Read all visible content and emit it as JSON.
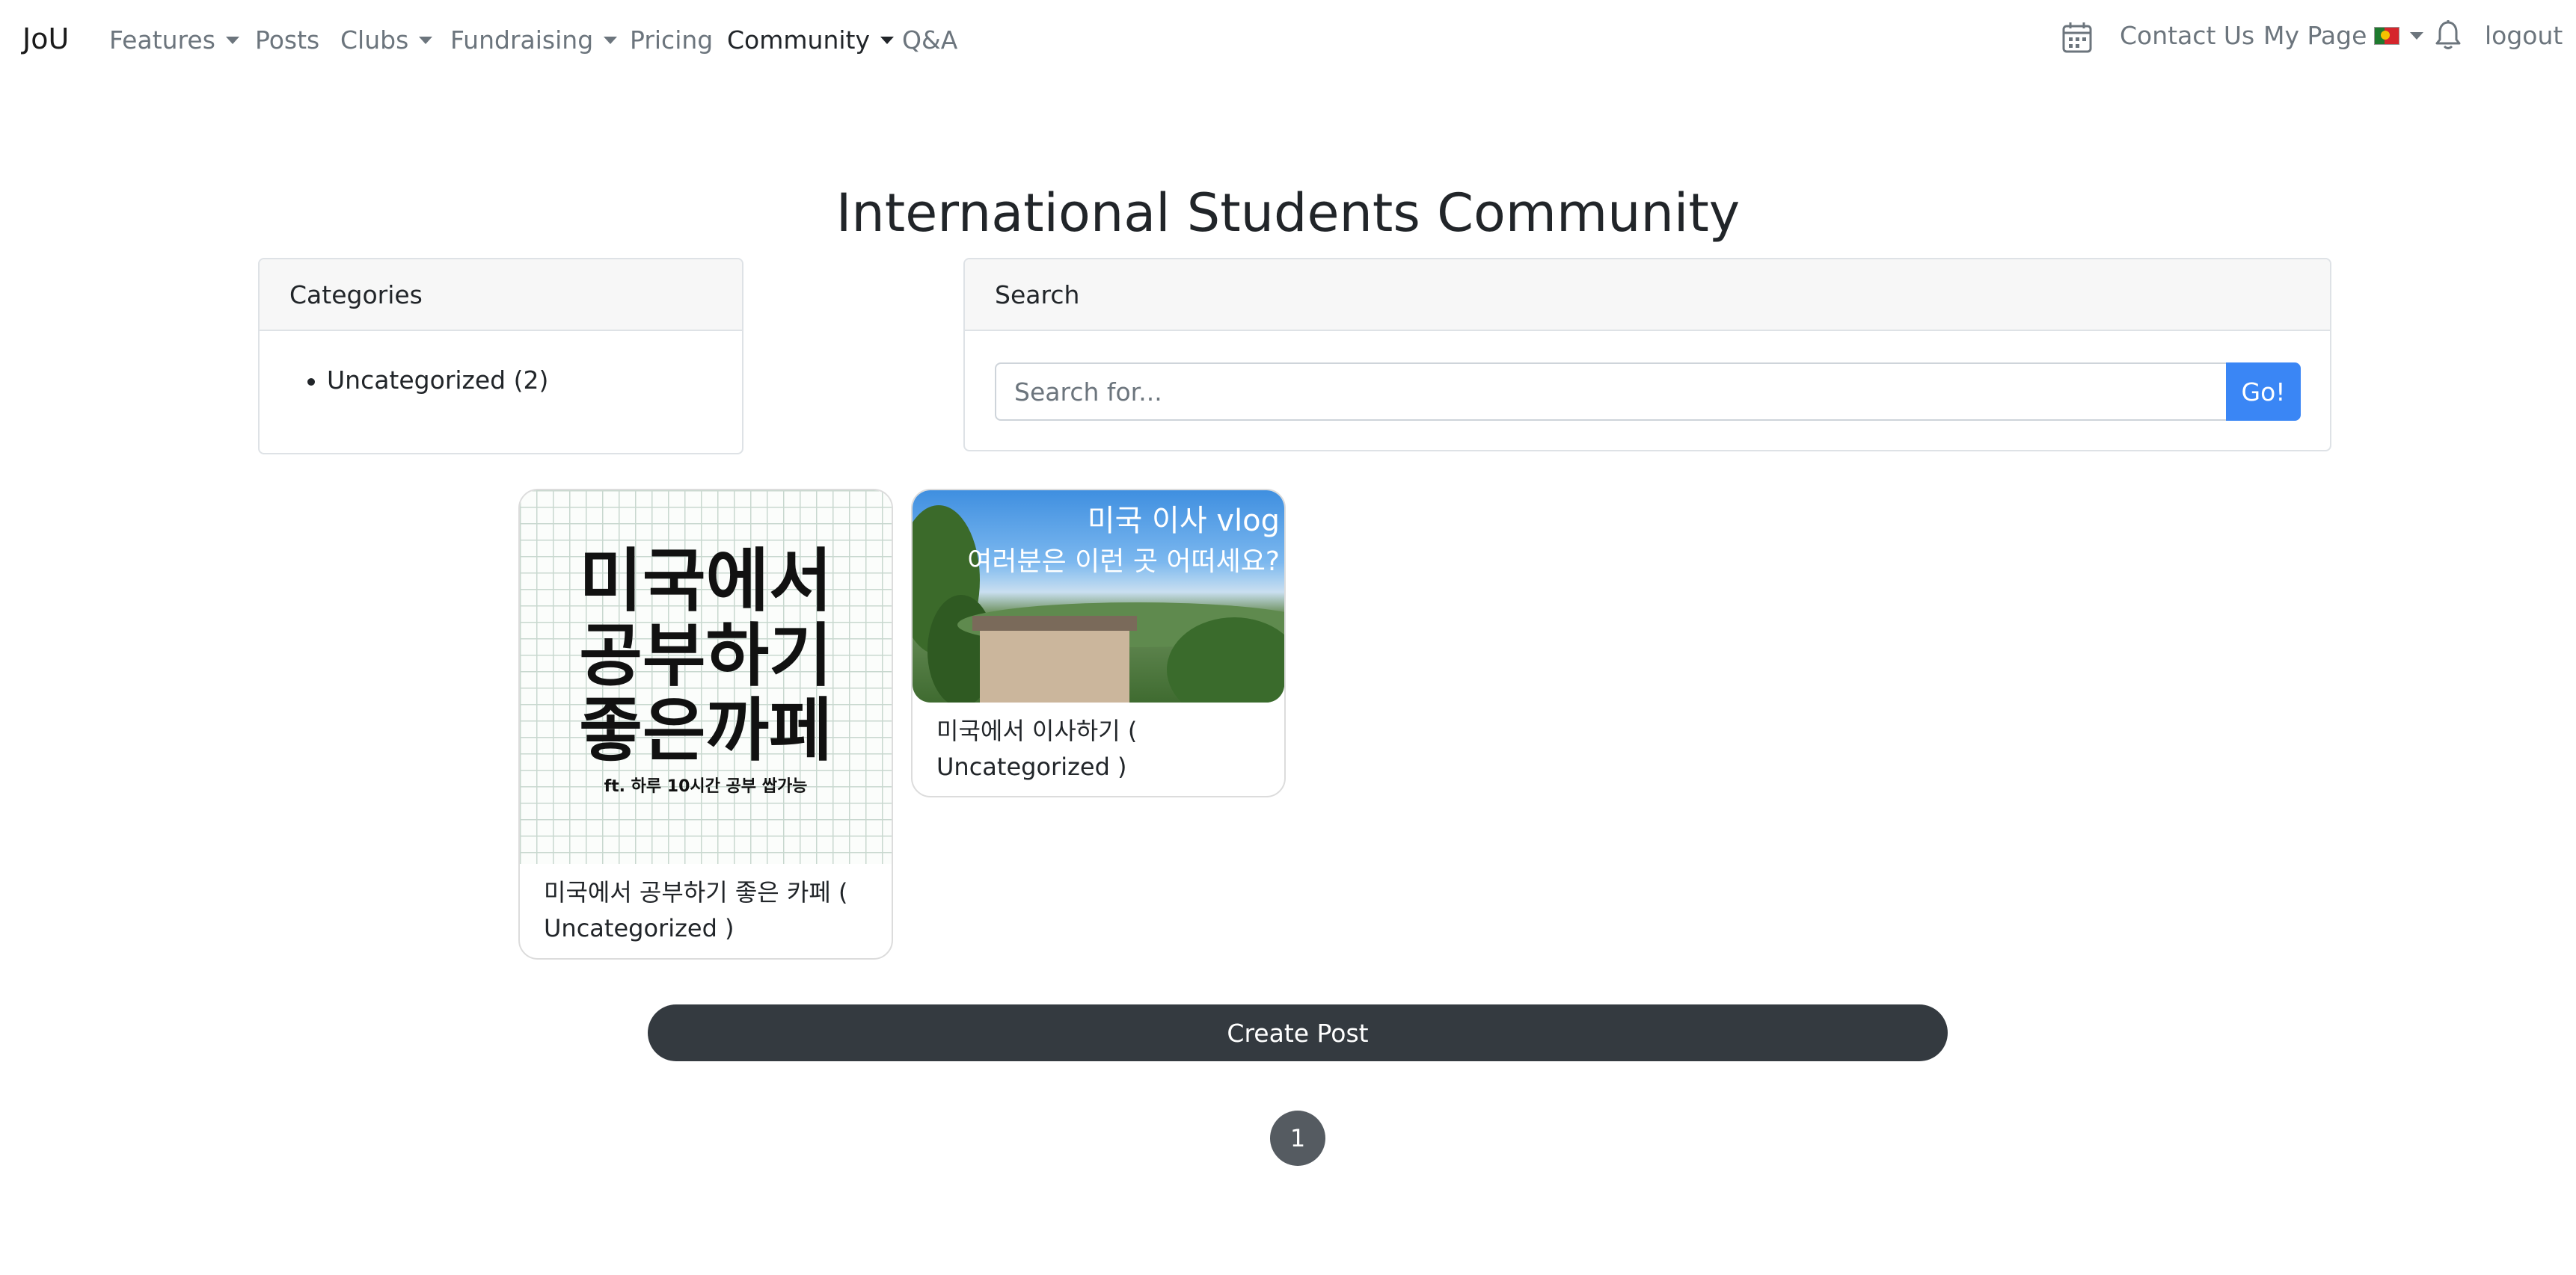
{
  "nav": {
    "brand": "JoU",
    "items": [
      {
        "label": "Features"
      },
      {
        "label": "Posts"
      },
      {
        "label": "Clubs"
      },
      {
        "label": "Fundraising"
      },
      {
        "label": "Pricing"
      },
      {
        "label": "Community"
      },
      {
        "label": "Q&A"
      }
    ],
    "right": {
      "calendar_icon": "calendar-icon",
      "contact": "Contact Us",
      "my_page": "My Page",
      "flag_icon": "portugal-flag-icon",
      "bell_icon": "bell-icon",
      "logout": "logout"
    }
  },
  "page": {
    "title": "International Students Community"
  },
  "categories": {
    "header": "Categories",
    "items": [
      {
        "label": "Uncategorized (2)"
      }
    ]
  },
  "search": {
    "header": "Search",
    "placeholder": "Search for...",
    "button": "Go!"
  },
  "posts": [
    {
      "thumb_lines": [
        "미국에서",
        "공부하기",
        "좋은까페"
      ],
      "thumb_sub": "ft. 하루 10시간 공부 쌉가능",
      "line1": "미국에서 공부하기 좋은 카페 (",
      "line2": "Uncategorized )"
    },
    {
      "thumb_top": "미국 이사 vlog",
      "thumb_mid": "여러분은 이런 곳 어떠세요?",
      "line1": "미국에서 이사하기 (",
      "line2": "Uncategorized )"
    }
  ],
  "actions": {
    "create_post": "Create Post"
  },
  "pagination": {
    "current": "1"
  },
  "colors": {
    "primary": "#3a86f5",
    "dark": "#343a40",
    "muted": "#6c757d"
  }
}
